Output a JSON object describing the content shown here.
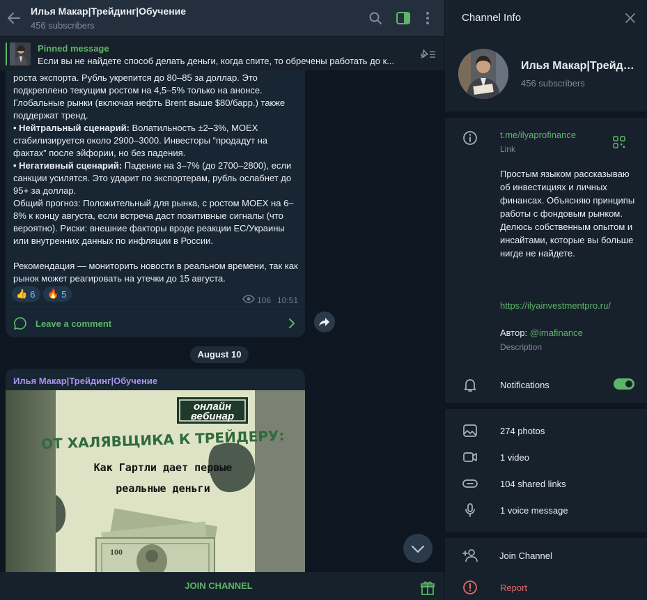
{
  "header": {
    "title": "Илья Макар|Трейдинг|Обучение",
    "subscribers": "456 subscribers"
  },
  "pinned": {
    "label": "Pinned message",
    "text": "Если вы не найдете способ делать деньги, когда спите, то обречены работать до к..."
  },
  "post1": {
    "lines": [
      {
        "bold": "",
        "text": "роста экспорта. Рубль укрепится до 80–85 за доллар. Это подкреплено текущим ростом на 4,5–5% только на анонсе. Глобальные рынки (включая нефть Brent выше $80/барр.) также поддержат тренд."
      },
      {
        "bold": "• Нейтральный сценарий:",
        "text": " Волатильность ±2–3%, MOEX стабилизируется около 2900–3000. Инвесторы “продадут на фактах” после эйфории, но без падения."
      },
      {
        "bold": "• Негативный сценарий:",
        "text": " Падение на 3–7% (до 2700–2800), если санкции усилятся. Это ударит по экспортерам, рубль ослабнет до 95+ за доллар."
      },
      {
        "bold": "",
        "text": "Общий прогноз: Положительный для рынка, с ростом MOEX на 6–8% к концу августа, если встреча даст позитивные сигналы (что вероятно). Риски: внешние факторы вроде реакции ЕС/Украины или внутренних данных по инфляции в России."
      },
      {
        "bold": "",
        "text": ""
      },
      {
        "bold": "",
        "text": "Рекомендация — мониторить новости в реальном времени, так как рынок может реагировать на утечки до 15 августа."
      }
    ],
    "reactions": [
      {
        "emoji": "👍",
        "count": "6"
      },
      {
        "emoji": "🔥",
        "count": "5"
      }
    ],
    "views": "106",
    "time": "10:51",
    "comment_label": "Leave a comment"
  },
  "date_chip": "August 10",
  "post2": {
    "author": "Илья Макар|Трейдинг|Обучение",
    "image": {
      "badge_line1": "онлайн",
      "badge_line2": "вебинар",
      "headline": "ОТ ХАЛЯВЩИКА К ТРЕЙДЕРУ:",
      "sub_line1": "Как Гартли дает первые",
      "sub_line2": "реальные деньги",
      "banknote_value": "100"
    }
  },
  "join_bar": {
    "label": "JOIN CHANNEL"
  },
  "info": {
    "title": "Channel Info",
    "name": "Илья Макар|Трейдинг|Обучение",
    "subscribers": "456 subscribers",
    "link": "t.me/ilyaprofinance",
    "link_caption": "Link",
    "description": "Простым языком рассказываю об инвестициях и личных финансах. Объясняю принципы работы с фондовым рынком. Делюсь собственным опытом и инсайтами, которые вы больше нигде не найдете.",
    "site": "https://ilyainvestmentpro.ru/",
    "author_prefix": "Автор: ",
    "author_handle": "@imafinance",
    "desc_caption": "Description",
    "notifications": "Notifications",
    "notifications_on": true,
    "media": {
      "photos": "274 photos",
      "video": "1 video",
      "links": "104 shared links",
      "voice": "1 voice message"
    },
    "join": "Join Channel",
    "report": "Report"
  },
  "colors": {
    "accent_green": "#5eb56a",
    "author_purple": "#a695e7",
    "report_red": "#e76a6a",
    "bubble": "#182533",
    "panel": "#17212b"
  }
}
